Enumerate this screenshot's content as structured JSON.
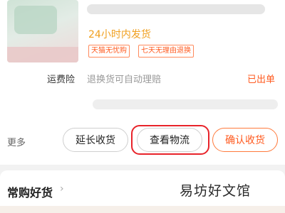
{
  "order": {
    "shipping_promise": "24小时内发货",
    "badges": [
      "天猫无忧购",
      "七天无理由退换"
    ]
  },
  "insurance": {
    "label": "运费险",
    "description": "退换货可自动理赔",
    "status": "已出单"
  },
  "actions": {
    "more_label": "更多",
    "extend_label": "延长收货",
    "logistics_label": "查看物流",
    "confirm_label": "确认收货"
  },
  "recommend": {
    "title": "常购好货",
    "chevron": "›"
  },
  "watermark": "易坊好文馆",
  "colors": {
    "accent_orange": "#ff5a1f",
    "promise_orange": "#f0a020",
    "highlight_red": "#e8232a"
  }
}
